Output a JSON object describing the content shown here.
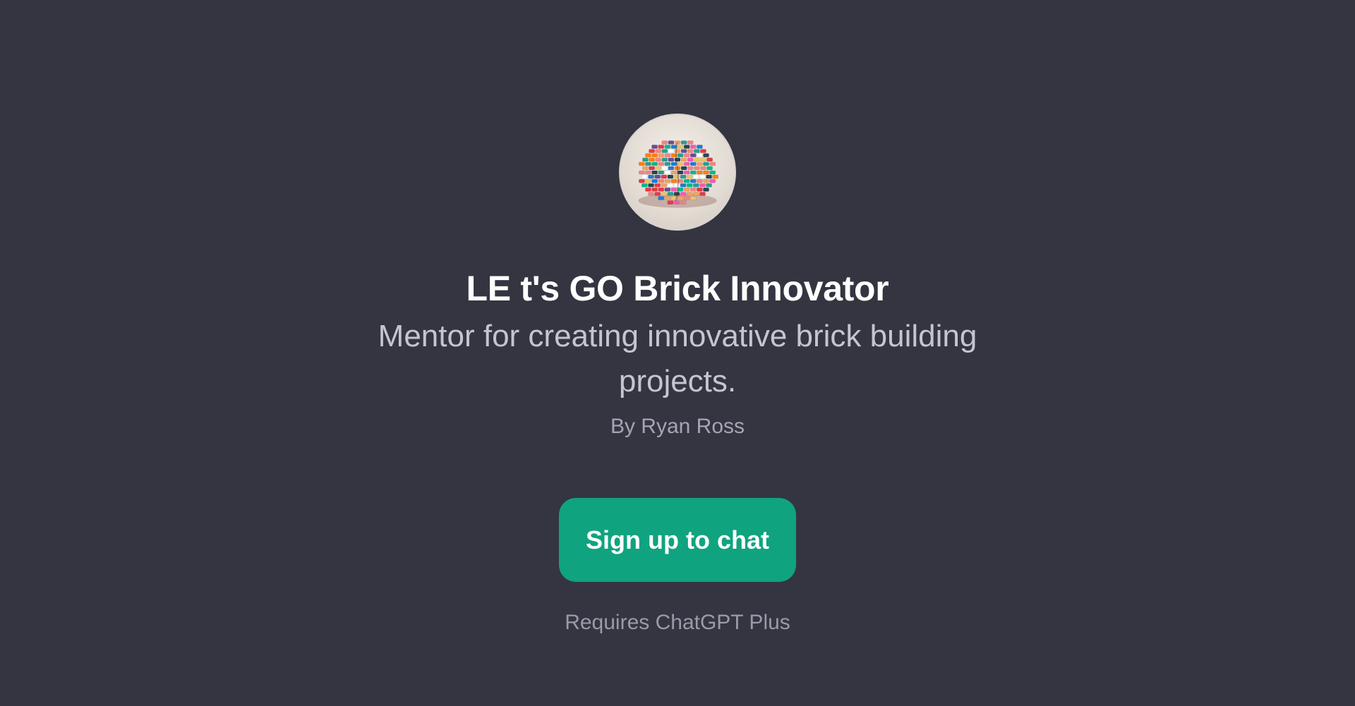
{
  "gpt": {
    "avatar_icon": "lego-brick-brain-icon",
    "title": "LE t's GO Brick Innovator",
    "description": "Mentor for creating innovative brick building projects.",
    "author": "By Ryan Ross"
  },
  "cta": {
    "label": "Sign up to chat"
  },
  "footer": {
    "requirement": "Requires ChatGPT Plus"
  },
  "colors": {
    "background": "#343541",
    "accent": "#10a37f",
    "title": "#ffffff",
    "subtitle": "#c5c5d2",
    "muted": "#a5a5b3"
  }
}
